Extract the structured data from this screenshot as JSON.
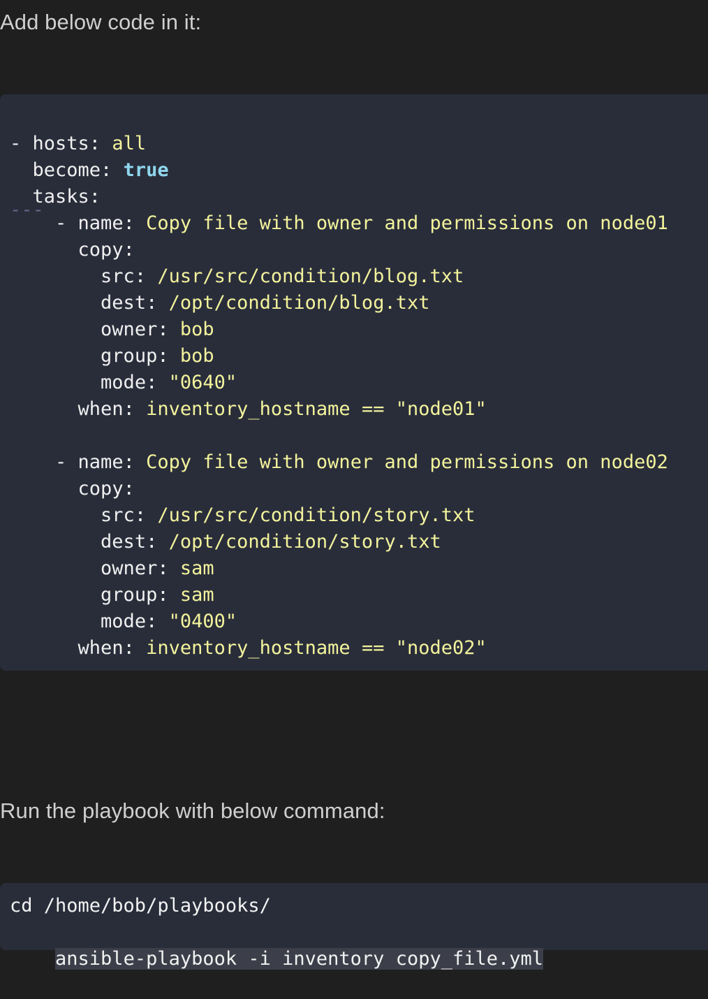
{
  "intro_text": "Add below code in it:",
  "yaml": {
    "doc_start": "---",
    "lines": [
      {
        "indent": "",
        "dash": "- ",
        "key": "hosts: ",
        "value": "all",
        "vtype": "s"
      },
      {
        "indent": "  ",
        "dash": "",
        "key": "become: ",
        "value": "true",
        "vtype": "b"
      },
      {
        "indent": "  ",
        "dash": "",
        "key": "tasks:",
        "value": "",
        "vtype": "s"
      },
      {
        "indent": "    ",
        "dash": "- ",
        "key": "name: ",
        "value": "Copy file with owner and permissions on node01",
        "vtype": "s"
      },
      {
        "indent": "      ",
        "dash": "",
        "key": "copy:",
        "value": "",
        "vtype": "s"
      },
      {
        "indent": "        ",
        "dash": "",
        "key": "src: ",
        "value": "/usr/src/condition/blog.txt",
        "vtype": "s"
      },
      {
        "indent": "        ",
        "dash": "",
        "key": "dest: ",
        "value": "/opt/condition/blog.txt",
        "vtype": "s"
      },
      {
        "indent": "        ",
        "dash": "",
        "key": "owner: ",
        "value": "bob",
        "vtype": "s"
      },
      {
        "indent": "        ",
        "dash": "",
        "key": "group: ",
        "value": "bob",
        "vtype": "s"
      },
      {
        "indent": "        ",
        "dash": "",
        "key": "mode: ",
        "value": "\"0640\"",
        "vtype": "s"
      },
      {
        "indent": "      ",
        "dash": "",
        "key": "when: ",
        "value": "inventory_hostname == \"node01\"",
        "vtype": "s"
      },
      {
        "indent": "",
        "dash": "",
        "key": "",
        "value": "",
        "vtype": "s"
      },
      {
        "indent": "    ",
        "dash": "- ",
        "key": "name: ",
        "value": "Copy file with owner and permissions on node02",
        "vtype": "s"
      },
      {
        "indent": "      ",
        "dash": "",
        "key": "copy:",
        "value": "",
        "vtype": "s"
      },
      {
        "indent": "        ",
        "dash": "",
        "key": "src: ",
        "value": "/usr/src/condition/story.txt",
        "vtype": "s"
      },
      {
        "indent": "        ",
        "dash": "",
        "key": "dest: ",
        "value": "/opt/condition/story.txt",
        "vtype": "s"
      },
      {
        "indent": "        ",
        "dash": "",
        "key": "owner: ",
        "value": "sam",
        "vtype": "s"
      },
      {
        "indent": "        ",
        "dash": "",
        "key": "group: ",
        "value": "sam",
        "vtype": "s"
      },
      {
        "indent": "        ",
        "dash": "",
        "key": "mode: ",
        "value": "\"0400\"",
        "vtype": "s"
      },
      {
        "indent": "      ",
        "dash": "",
        "key": "when: ",
        "value": "inventory_hostname == \"node02\"",
        "vtype": "s"
      }
    ]
  },
  "run_text": "Run the playbook with below command:",
  "command": {
    "line1": "cd /home/bob/playbooks/",
    "line2": "ansible-playbook -i inventory copy_file.yml"
  },
  "colors": {
    "page_bg": "#1f1f1f",
    "code_bg": "#292d3a",
    "key": "#f0f0f0",
    "string": "#f3f39c",
    "boolean": "#8fd7ee",
    "comment": "#5f6986"
  }
}
